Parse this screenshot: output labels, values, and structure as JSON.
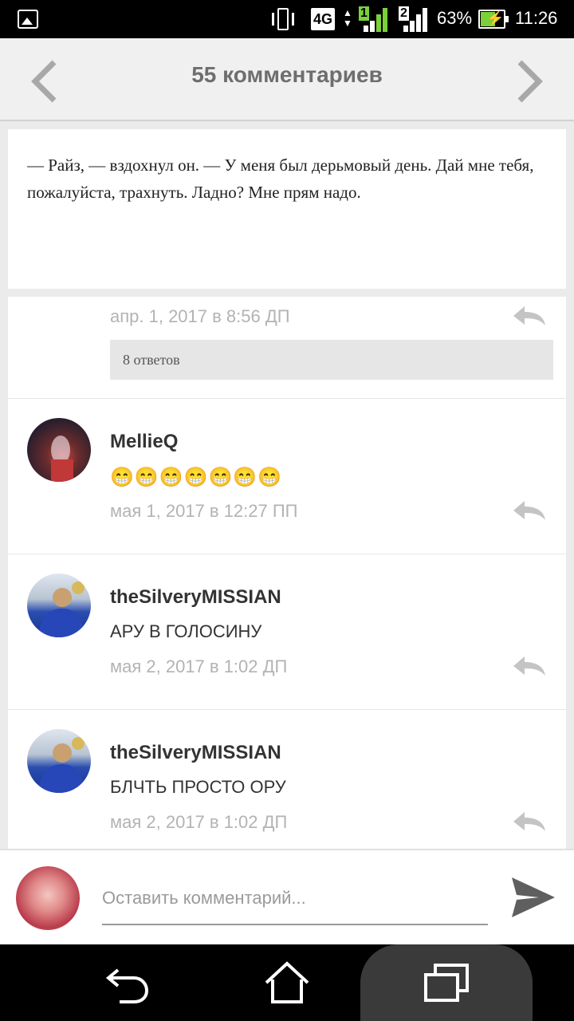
{
  "status_bar": {
    "network": "4G",
    "sim1": "1",
    "sim2": "2",
    "battery": "63%",
    "battery_level": 0.63,
    "time": "11:26"
  },
  "header": {
    "title": "55 комментариев"
  },
  "post": {
    "text": "— Райз, — вздохнул он. — У меня был дерьмовый день. Дай мне тебя, пожалуйста, трахнуть. Ладно? Мне прям надо."
  },
  "comments": {
    "first": {
      "date": "апр. 1, 2017 в 8:56 ДП",
      "replies": "8 ответов"
    },
    "items": [
      {
        "username": "MellieQ",
        "text": "😁😁😁😁😁😁😁",
        "date": "мая 1, 2017 в 12:27 ПП"
      },
      {
        "username": "theSilveryMISSIAN",
        "text": "АРУ В ГОЛОСИНУ",
        "date": "мая 2, 2017 в 1:02 ДП"
      },
      {
        "username": "theSilveryMISSIAN",
        "text": "БЛЧТЬ ПРОСТО ОРУ",
        "date": "мая 2, 2017 в 1:02 ДП"
      }
    ]
  },
  "composer": {
    "placeholder": "Оставить комментарий..."
  },
  "colors": {
    "status_bar_bg": "#000000",
    "header_bg": "#f0f0f0",
    "muted_text": "#b3b3b3",
    "battery_green": "#7bd13a"
  },
  "icons": [
    "gallery-icon",
    "vibrate-icon",
    "signal-icon",
    "battery-icon",
    "back-chevron-icon",
    "forward-chevron-icon",
    "reply-icon",
    "send-icon",
    "nav-back-icon",
    "nav-home-icon",
    "nav-recents-icon"
  ]
}
